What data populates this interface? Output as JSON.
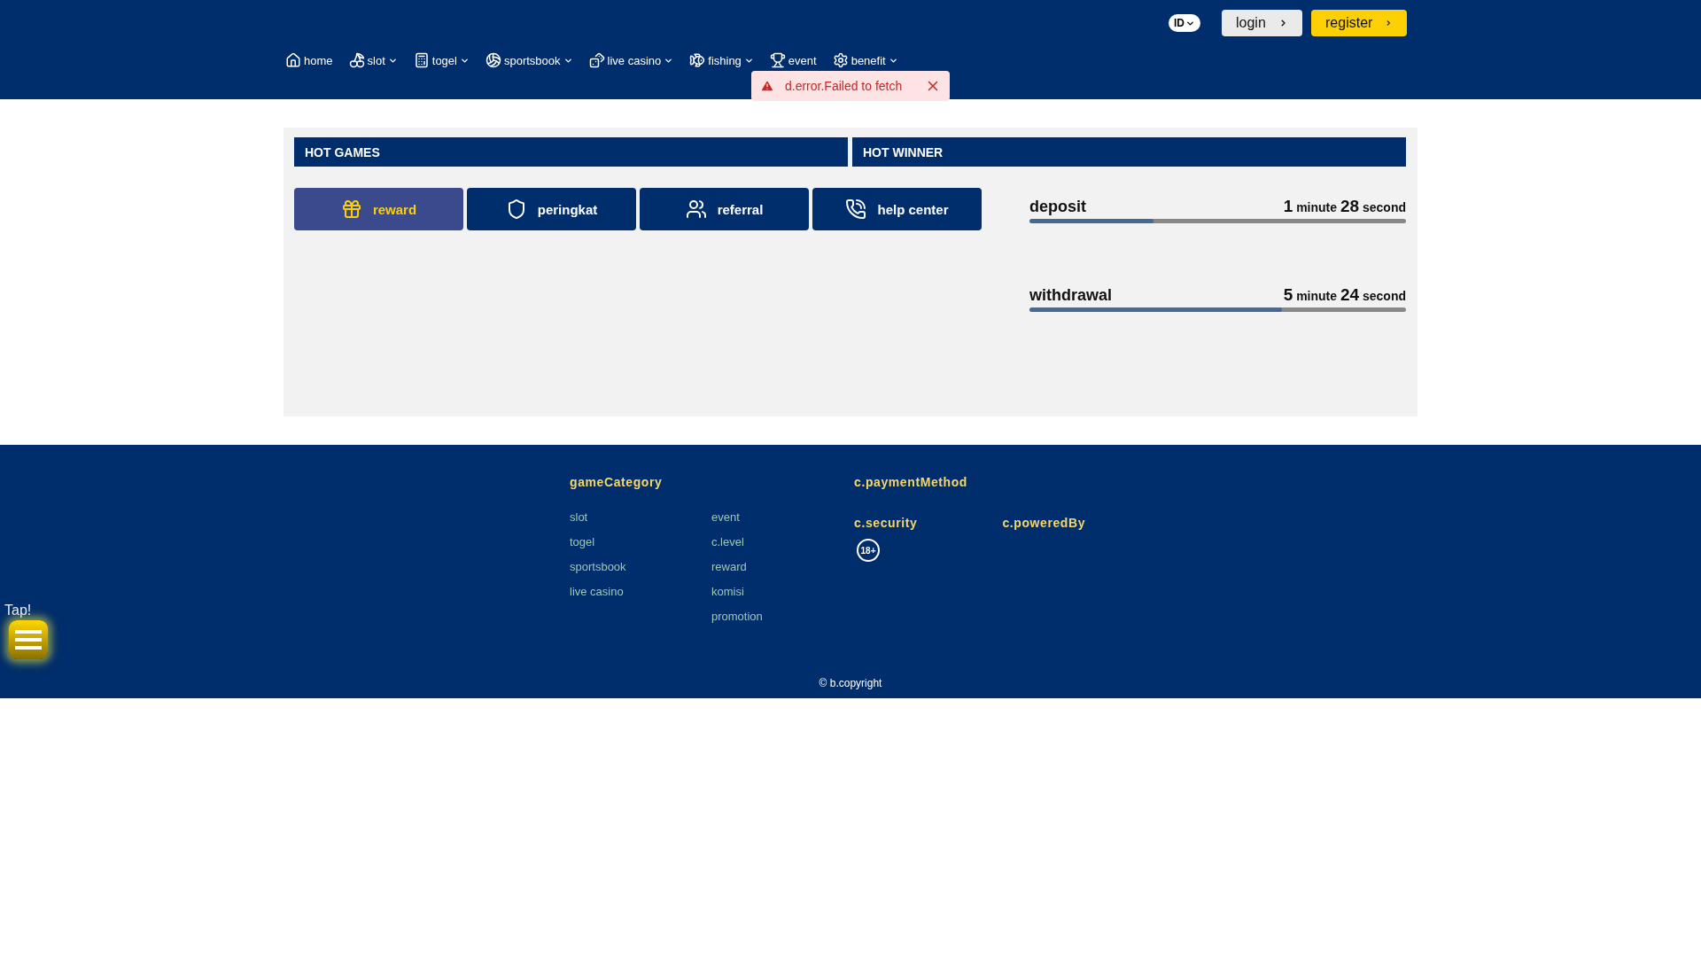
{
  "header": {
    "language": "ID",
    "login": "login",
    "register": "register",
    "nav": [
      {
        "label": "home",
        "dropdown": false
      },
      {
        "label": "slot",
        "dropdown": true
      },
      {
        "label": "togel",
        "dropdown": true
      },
      {
        "label": "sportsbook",
        "dropdown": true
      },
      {
        "label": "live casino",
        "dropdown": true
      },
      {
        "label": "fishing",
        "dropdown": true
      },
      {
        "label": "event",
        "dropdown": false
      },
      {
        "label": "benefit",
        "dropdown": true
      }
    ]
  },
  "toast": {
    "message": "d.error.Failed to fetch"
  },
  "hot_games": {
    "title": "HOT GAMES",
    "tabs": [
      {
        "label": "reward",
        "selected": true
      },
      {
        "label": "peringkat",
        "selected": false
      },
      {
        "label": "referral",
        "selected": false
      },
      {
        "label": "help center",
        "selected": false
      }
    ]
  },
  "hot_winner": {
    "title": "HOT WINNER",
    "rows": [
      {
        "label": "deposit",
        "minutes": "1",
        "minute_unit": "minute",
        "seconds": "28",
        "second_unit": "second",
        "level": 0.33
      },
      {
        "label": "withdrawal",
        "minutes": "5",
        "minute_unit": "minute",
        "seconds": "24",
        "second_unit": "second",
        "level": 0.67
      }
    ]
  },
  "footer": {
    "game_category": {
      "title": "gameCategory",
      "columns": [
        [
          "slot",
          "togel",
          "sportsbook",
          "live casino"
        ],
        [
          "event",
          "c.level",
          "reward",
          "komisi",
          "promotion"
        ]
      ]
    },
    "payment_method": {
      "title": "c.paymentMethod"
    },
    "security": {
      "title": "c.security",
      "badge": "18+"
    },
    "powered_by": {
      "title": "c.poweredBy"
    },
    "copyright": "© b.copyright"
  },
  "floating_menu": {
    "label": "Tap!"
  }
}
